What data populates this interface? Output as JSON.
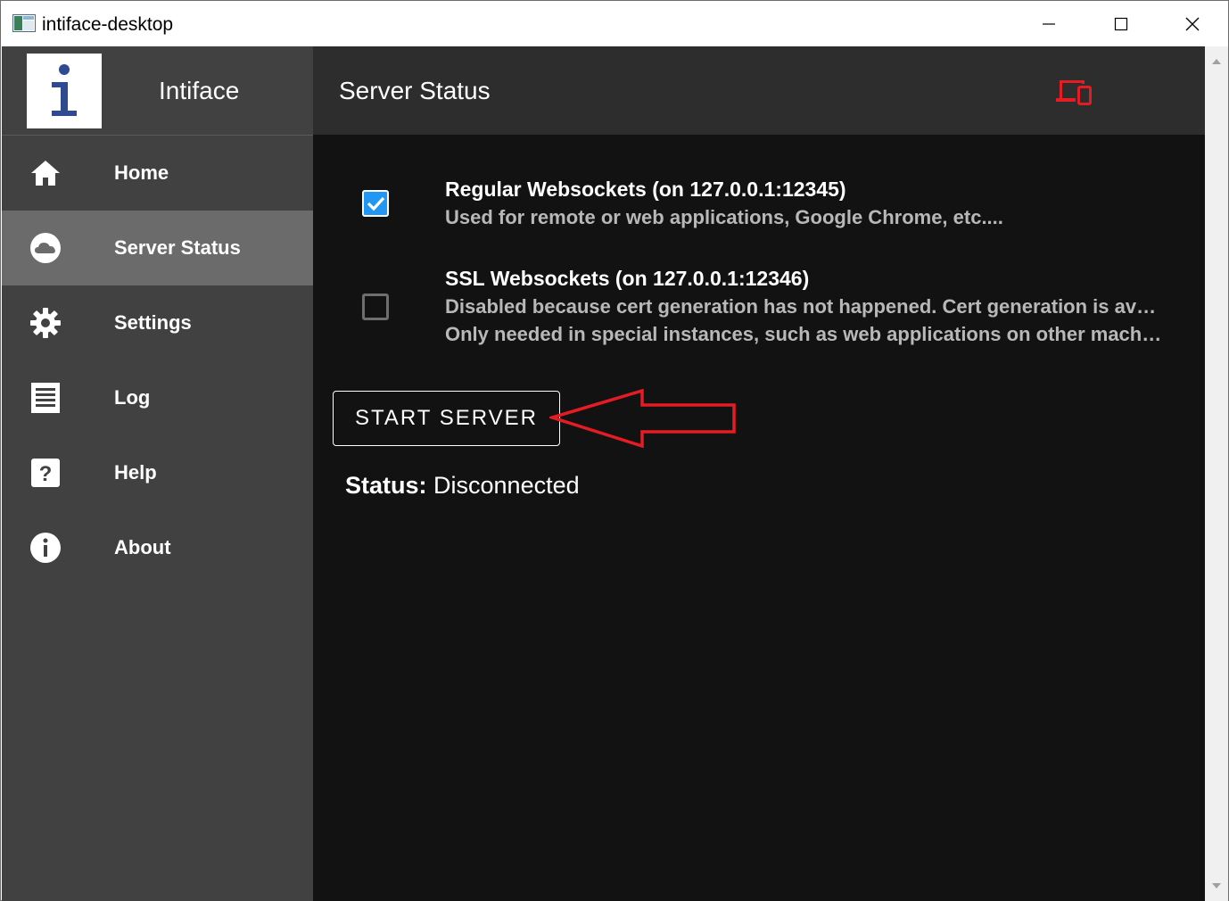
{
  "window": {
    "title": "intiface-desktop"
  },
  "sidebar": {
    "brand": "Intiface",
    "items": [
      {
        "label": "Home",
        "icon": "home-icon",
        "active": false
      },
      {
        "label": "Server Status",
        "icon": "cloud-icon",
        "active": true
      },
      {
        "label": "Settings",
        "icon": "gear-icon",
        "active": false
      },
      {
        "label": "Log",
        "icon": "log-icon",
        "active": false
      },
      {
        "label": "Help",
        "icon": "help-icon",
        "active": false
      },
      {
        "label": "About",
        "icon": "info-icon",
        "active": false
      }
    ]
  },
  "appbar": {
    "title": "Server Status",
    "device_icon_color": "#e51c23"
  },
  "main": {
    "options": [
      {
        "title": "Regular Websockets (on 127.0.0.1:12345)",
        "description_lines": [
          "Used for remote or web applications, Google Chrome, etc...."
        ],
        "checked": true
      },
      {
        "title": "SSL Websockets (on 127.0.0.1:12346)",
        "description_lines": [
          "Disabled because cert generation has not happened. Cert generation is availa...",
          "Only needed in special instances, such as web applications on other machine..."
        ],
        "checked": false
      }
    ],
    "start_button_label": "START SERVER",
    "status_label": "Status:",
    "status_value": "Disconnected"
  },
  "colors": {
    "sidebar_bg": "#414141",
    "sidebar_active": "#6b6b6b",
    "appbar_bg": "#2d2d2d",
    "main_bg": "#121212",
    "checkbox_checked": "#2196f3",
    "annotation_red": "#e51c23"
  }
}
